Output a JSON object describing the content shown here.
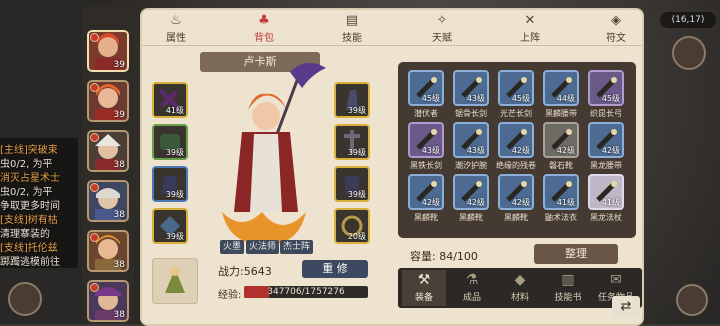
{
  "tabs": [
    {
      "label": "属性",
      "icon": "flame-icon"
    },
    {
      "label": "背包",
      "icon": "bag-icon"
    },
    {
      "label": "技能",
      "icon": "book-icon"
    },
    {
      "label": "天赋",
      "icon": "star-icon"
    },
    {
      "label": "上阵",
      "icon": "swords-icon"
    },
    {
      "label": "符文",
      "icon": "rune-icon"
    }
  ],
  "active_tab": "背包",
  "hero": {
    "name": "卢卡斯",
    "skills": [
      "火墨",
      "火法师",
      "杰士阵"
    ],
    "combat_label": "战力:",
    "combat_value": "5643",
    "repair_label": "重 修",
    "exp_label": "经验:",
    "exp_text": "347706/1757276",
    "exp_progress": 0.198
  },
  "equipment": [
    {
      "level": "41级"
    },
    {
      "level": "39级"
    },
    {
      "level": "39级"
    },
    {
      "level": "39级"
    },
    {
      "level": "39级"
    },
    {
      "level": "39级"
    },
    {
      "level": "39级"
    },
    {
      "level": "20级"
    }
  ],
  "portraits": [
    {
      "level": "39"
    },
    {
      "level": "39"
    },
    {
      "level": "38"
    },
    {
      "level": "38"
    },
    {
      "level": "38"
    },
    {
      "level": "38"
    }
  ],
  "inventory": {
    "items": [
      {
        "level": "45级",
        "name": "潜伏者",
        "rarity": "blue"
      },
      {
        "level": "43级",
        "name": "锯骨长剑",
        "rarity": "blue"
      },
      {
        "level": "45级",
        "name": "光芒长剑",
        "rarity": "blue"
      },
      {
        "level": "44级",
        "name": "黑麟腰带",
        "rarity": "blue"
      },
      {
        "level": "45级",
        "name": "织昆长弓",
        "rarity": "purple"
      },
      {
        "level": "43级",
        "name": "黑铁长剑",
        "rarity": "purple"
      },
      {
        "level": "43级",
        "name": "潮汐护腕",
        "rarity": "blue"
      },
      {
        "level": "42级",
        "name": "绝缘的残卷",
        "rarity": "blue"
      },
      {
        "level": "42级",
        "name": "磐石靴",
        "rarity": "gray"
      },
      {
        "level": "42级",
        "name": "黑龙腰带",
        "rarity": "blue"
      },
      {
        "level": "42级",
        "name": "黑麟靴",
        "rarity": "blue"
      },
      {
        "level": "42级",
        "name": "黑麟靴",
        "rarity": "blue"
      },
      {
        "level": "42级",
        "name": "黑麟靴",
        "rarity": "blue"
      },
      {
        "level": "41级",
        "name": "鼬术法衣",
        "rarity": "blue"
      },
      {
        "level": "41级",
        "name": "黑龙法杖",
        "rarity": "light"
      }
    ],
    "capacity_label": "容量:",
    "capacity_value": "84/100",
    "sort_label": "整理"
  },
  "categories": [
    {
      "label": "装备",
      "icon": "hammer-icon"
    },
    {
      "label": "成品",
      "icon": "potion-icon"
    },
    {
      "label": "材料",
      "icon": "ore-icon"
    },
    {
      "label": "技能书",
      "icon": "skillbook-icon"
    },
    {
      "label": "任务物品",
      "icon": "scroll-icon"
    }
  ],
  "active_category": "装备",
  "quest_log": [
    "[主线]突破束",
    "虫0/2, 为平",
    "消灭占星术士",
    "虫0/2, 为平",
    "争取更多时间",
    "[支线]树有枯",
    "清理寨装的",
    "[支线]托伦兹",
    "踯躅逃模前往"
  ],
  "coords": "(16,17)"
}
